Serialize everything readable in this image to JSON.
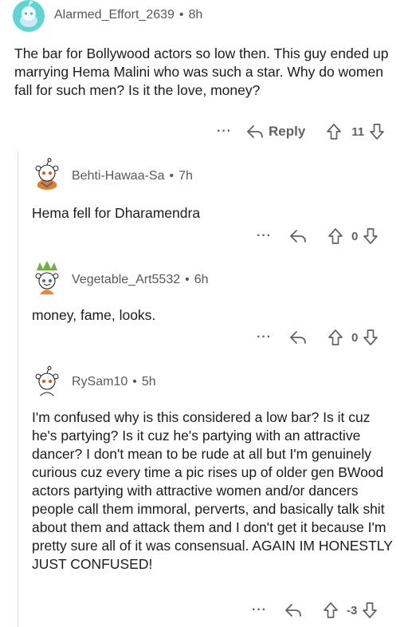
{
  "comments": [
    {
      "username": "Alarmed_Effort_2639",
      "age": "8h",
      "body": "The bar for Bollywood actors so low then. This guy ended up marrying Hema Malini who was such a star. Why do women fall for such men? Is it the love, money?",
      "reply_label": "Reply",
      "score": "11",
      "more": "···"
    },
    {
      "username": "Behti-Hawaa-Sa",
      "age": "7h",
      "body": "Hema fell for Dharamendra",
      "score": "0",
      "more": "···"
    },
    {
      "username": "Vegetable_Art5532",
      "age": "6h",
      "body": "money, fame, looks.",
      "score": "0",
      "more": "···"
    },
    {
      "username": "RySam10",
      "age": "5h",
      "body": "I'm confused why is this considered a low bar? Is it cuz he's partying? Is it cuz he's partying with an attractive dancer? I don't mean to be rude at all but I'm genuinely curious cuz every time a pic rises up of older gen BWood actors partying with attractive women and/or dancers people call them immoral, perverts, and basically talk shit about them and attack them and I don't get it because I'm pretty sure all of it was consensual. AGAIN IM HONESTLY JUST CONFUSED!",
      "score": "-3",
      "more": "···"
    }
  ],
  "separator": "•",
  "icons": {
    "reply": "reply-arrow-icon",
    "upvote": "upvote-arrow-icon",
    "downvote": "downvote-arrow-icon",
    "avatar": "reddit-snoo-avatar"
  }
}
